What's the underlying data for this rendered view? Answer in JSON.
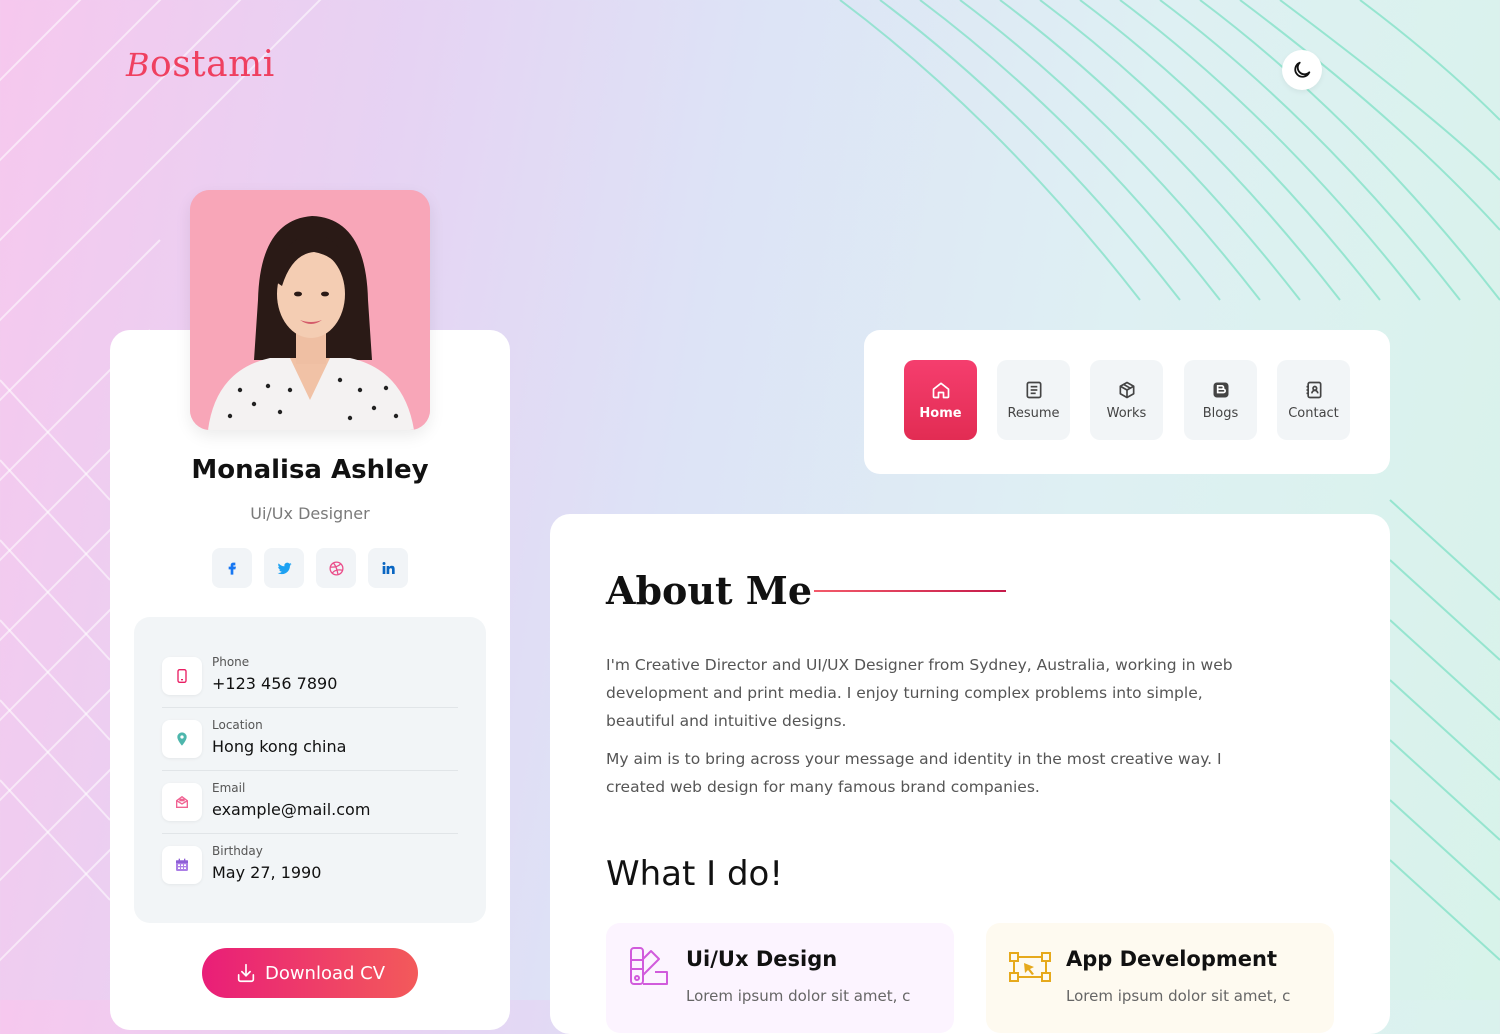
{
  "brand": {
    "logo_initial": "B",
    "logo_rest": "ostami"
  },
  "theme_toggle": {
    "icon": "moon-icon"
  },
  "profile": {
    "name": "Monalisa Ashley",
    "role": "Ui/Ux Designer",
    "socials": [
      {
        "name": "facebook",
        "icon": "facebook-icon",
        "color": "#1877f2"
      },
      {
        "name": "twitter",
        "icon": "twitter-icon",
        "color": "#1da1f2"
      },
      {
        "name": "dribbble",
        "icon": "dribbble-icon",
        "color": "#ea4c89"
      },
      {
        "name": "linkedin",
        "icon": "linkedin-icon",
        "color": "#0a66c2"
      }
    ],
    "info": [
      {
        "label": "Phone",
        "value": "+123 456 7890",
        "icon": "phone-icon",
        "color": "#e91e63"
      },
      {
        "label": "Location",
        "value": "Hong kong china",
        "icon": "location-icon",
        "color": "#4db6ac"
      },
      {
        "label": "Email",
        "value": "example@mail.com",
        "icon": "email-icon",
        "color": "#f06292"
      },
      {
        "label": "Birthday",
        "value": "May 27, 1990",
        "icon": "calendar-icon",
        "color": "#ab7ee6"
      }
    ],
    "download_label": "Download CV"
  },
  "nav": {
    "items": [
      {
        "label": "Home",
        "icon": "home-icon",
        "active": true
      },
      {
        "label": "Resume",
        "icon": "resume-icon",
        "active": false
      },
      {
        "label": "Works",
        "icon": "works-icon",
        "active": false
      },
      {
        "label": "Blogs",
        "icon": "blogs-icon",
        "active": false
      },
      {
        "label": "Contact",
        "icon": "contact-icon",
        "active": false
      }
    ]
  },
  "about": {
    "title": "About Me",
    "paragraph1": "I'm Creative Director and UI/UX Designer from Sydney, Australia, working in web development and print media. I enjoy turning complex problems into simple, beautiful and intuitive designs.",
    "paragraph2": "My aim is to bring across your message and identity in the most creative way. I created web design for many famous brand companies."
  },
  "what_i_do": {
    "title": "What I do!",
    "services": [
      {
        "title": "Ui/Ux Design",
        "desc": "Lorem ipsum dolor sit amet, c",
        "icon": "design-swatch-icon",
        "bg": "#fcf4ff",
        "accent": "#d15bdc"
      },
      {
        "title": "App Development",
        "desc": "Lorem ipsum dolor sit amet, c",
        "icon": "app-dev-icon",
        "bg": "#fefaf0",
        "accent": "#e6a91c"
      }
    ]
  },
  "colors": {
    "accent": "#ef4060",
    "button_gradient_start": "#e91e78",
    "button_gradient_end": "#f35a5a"
  }
}
